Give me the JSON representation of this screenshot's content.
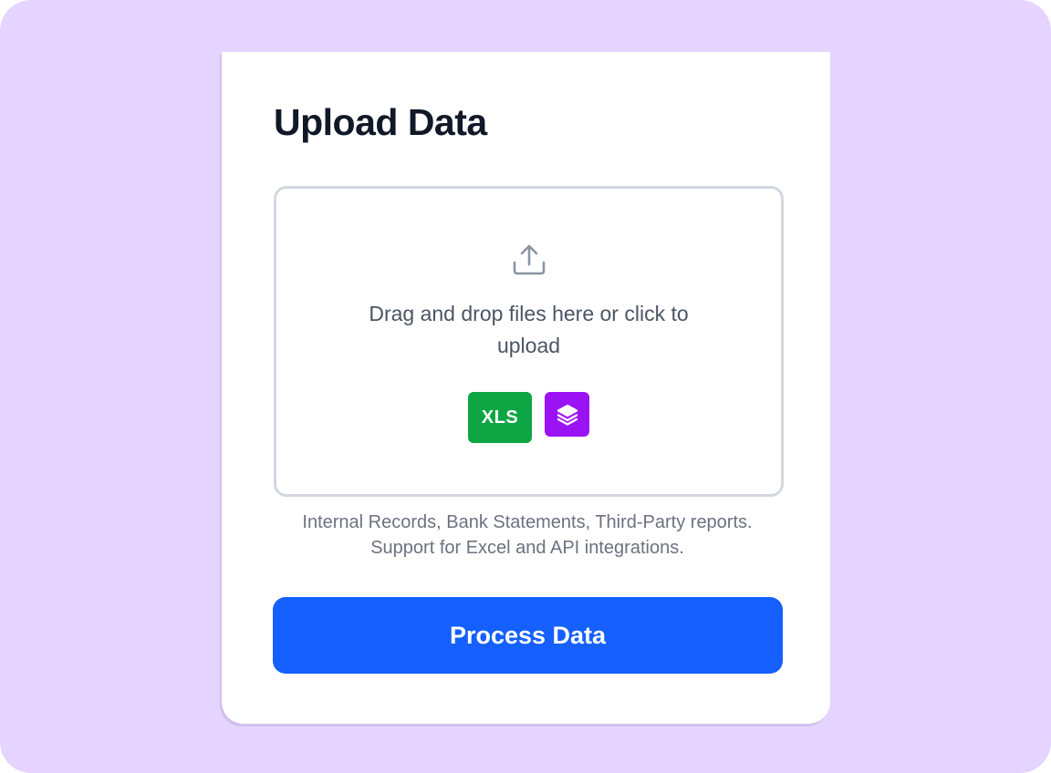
{
  "card": {
    "title": "Upload Data"
  },
  "dropzone": {
    "icon": "upload-icon",
    "line1": "Drag and drop files here or click to",
    "line2": "upload",
    "badges": [
      {
        "label": "XLS",
        "color": "#0ea544"
      },
      {
        "label": "",
        "icon": "layers-icon",
        "color": "#9b13f4"
      }
    ]
  },
  "help": {
    "line1": "Internal Records, Bank Statements, Third-Party reports.",
    "line2": "Support for Excel and API integrations."
  },
  "actions": {
    "process_label": "Process Data"
  },
  "colors": {
    "background": "#e4d4ff",
    "primary": "#1560ff",
    "xls_badge": "#0ea544",
    "api_badge": "#9b13f4"
  }
}
